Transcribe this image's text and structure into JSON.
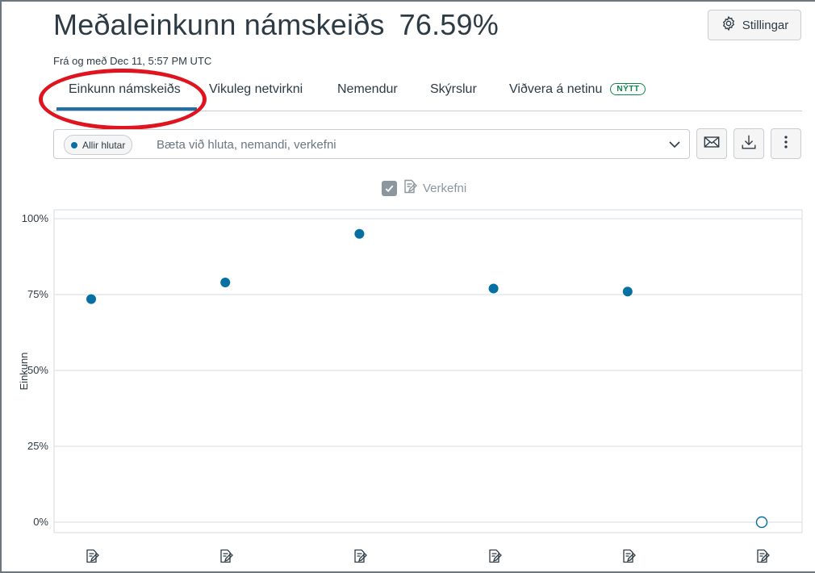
{
  "header": {
    "title": "Meðaleinkunn námskeiðs",
    "average": "76.59%",
    "subtitle": "Frá og með Dec 11, 5:57 PM UTC",
    "settings_label": "Stillingar",
    "settings_icon": "gear-icon"
  },
  "tabs": [
    {
      "label": "Einkunn námskeiðs",
      "active": true
    },
    {
      "label": "Vikuleg netvirkni",
      "active": false
    },
    {
      "label": "Nemendur",
      "active": false
    },
    {
      "label": "Skýrslur",
      "active": false
    },
    {
      "label": "Viðvera á netinu",
      "active": false,
      "badge": "NÝTT"
    }
  ],
  "filter": {
    "chip_label": "Allir hlutar",
    "placeholder": "Bæta við hluta, nemandi, verkefni",
    "dropdown_icon": "chevron-down-icon"
  },
  "actions": {
    "message_icon": "envelope-icon",
    "download_icon": "download-icon",
    "more_icon": "more-vertical-icon"
  },
  "legend": {
    "label": "Verkefni",
    "checked": true,
    "icon": "assignment-icon"
  },
  "colors": {
    "accent": "#0770a3",
    "tab_underline": "#1f6fa8",
    "badge": "#0b874b",
    "annotation": "#e0141e"
  },
  "chart_data": {
    "type": "scatter",
    "ylabel": "Einkunn",
    "ylim": [
      0,
      100
    ],
    "yticks": [
      "100%",
      "75%",
      "50%",
      "25%",
      "0%"
    ],
    "ytick_values": [
      100,
      75,
      50,
      25,
      0
    ],
    "grid": true,
    "series": [
      {
        "x": [
          1,
          2,
          3,
          4,
          5,
          6
        ],
        "values": [
          73.5,
          79,
          95,
          77,
          76,
          0
        ],
        "filled": [
          true,
          true,
          true,
          true,
          true,
          false
        ]
      }
    ],
    "x_icon": "assignment-icon"
  }
}
